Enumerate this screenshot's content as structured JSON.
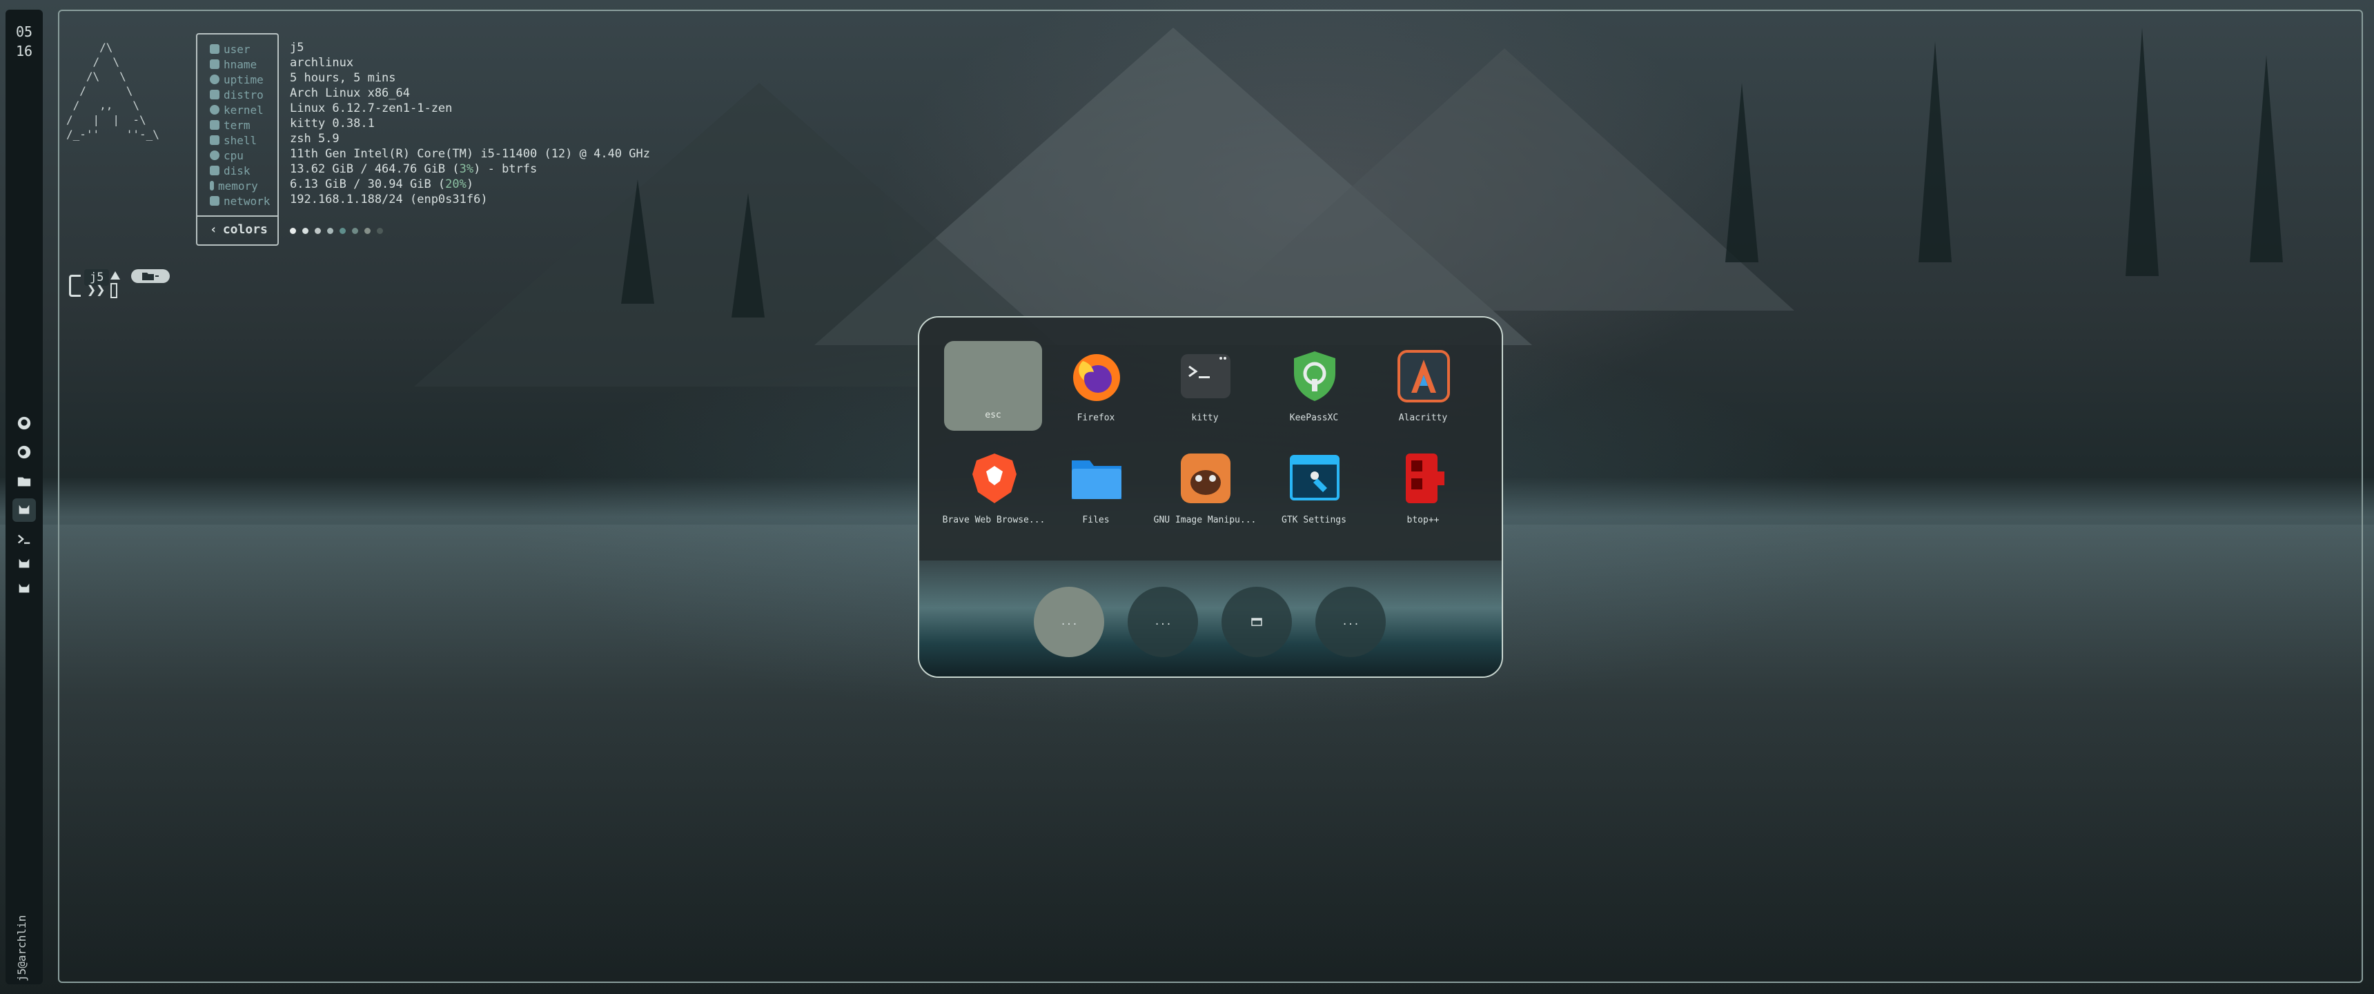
{
  "clock": {
    "hour": "05",
    "minute": "16"
  },
  "host_label": "j5@archlin",
  "workspaces": [
    {
      "icon": "github-icon"
    },
    {
      "icon": "firefox-icon"
    },
    {
      "icon": "folder-icon"
    },
    {
      "icon": "cat-icon",
      "active": true
    },
    {
      "icon": "terminal-icon"
    },
    {
      "icon": "cat-icon"
    },
    {
      "icon": "cat-icon"
    }
  ],
  "ascii_logo": "     /\\\n    /  \\\n   /\\   \\\n  /      \\\n /   ,,   \\\n/   |  |  -\\\n/_-''    ''-_\\",
  "fetch": {
    "keys": [
      {
        "label": "user",
        "icon": "user-icon"
      },
      {
        "label": "hname",
        "icon": "host-icon"
      },
      {
        "label": "uptime",
        "icon": "clock-icon"
      },
      {
        "label": "distro",
        "icon": "distro-icon"
      },
      {
        "label": "kernel",
        "icon": "gear-icon"
      },
      {
        "label": "term",
        "icon": "terminal-icon"
      },
      {
        "label": "shell",
        "icon": "shell-icon"
      },
      {
        "label": "cpu",
        "icon": "cpu-icon"
      },
      {
        "label": "disk",
        "icon": "disk-icon"
      },
      {
        "label": "memory",
        "icon": "memory-icon"
      },
      {
        "label": "network",
        "icon": "network-icon"
      }
    ],
    "values": {
      "user": "j5",
      "hname": "archlinux",
      "uptime": "5 hours, 5 mins",
      "distro": "Arch Linux x86_64",
      "kernel": "Linux 6.12.7-zen1-1-zen",
      "term": "kitty 0.38.1",
      "shell": "zsh 5.9",
      "cpu": "11th Gen Intel(R) Core(TM) i5-11400 (12) @ 4.40 GHz",
      "disk_pre": "13.62 GiB / 464.76 GiB (",
      "disk_pct": "3%",
      "disk_post": ") - btrfs",
      "memory_pre": "6.13 GiB / 30.94 GiB (",
      "memory_pct": "20%",
      "memory_post": ")",
      "network": "192.168.1.188/24 (enp0s31f6)"
    },
    "colors_label": "colors",
    "palette": [
      "#e8ecec",
      "#d8e0e0",
      "#c0c8c8",
      "#a8b8b8",
      "#5f8f8c",
      "#6f8a86",
      "#86908a",
      "#4d5a58"
    ]
  },
  "prompt": {
    "user": "j5",
    "chevron": "❯❯",
    "dir_icon": "folder-icon"
  },
  "launcher": {
    "esc_label": "esc",
    "apps": [
      {
        "label": "Firefox",
        "icon": "firefox-icon"
      },
      {
        "label": "kitty",
        "icon": "kitty-icon"
      },
      {
        "label": "KeePassXC",
        "icon": "keepassxc-icon"
      },
      {
        "label": "Alacritty",
        "icon": "alacritty-icon"
      },
      {
        "label": "Brave Web Browse...",
        "icon": "brave-icon"
      },
      {
        "label": "Files",
        "icon": "files-icon"
      },
      {
        "label": "GNU Image Manipu...",
        "icon": "gimp-icon"
      },
      {
        "label": "GTK Settings",
        "icon": "gtk-settings-icon"
      },
      {
        "label": "btop++",
        "icon": "btop-icon"
      }
    ],
    "dock": [
      {
        "label": "...",
        "icon": "dock-1-icon"
      },
      {
        "label": "...",
        "icon": "dock-2-icon"
      },
      {
        "label": "",
        "icon": "window-icon"
      },
      {
        "label": "...",
        "icon": "dock-4-icon"
      }
    ]
  },
  "colors": {
    "accent": "#8a9e9c",
    "key": "#7fa3a6",
    "text": "#d8e0e0",
    "percent": "#8cc0a2"
  }
}
